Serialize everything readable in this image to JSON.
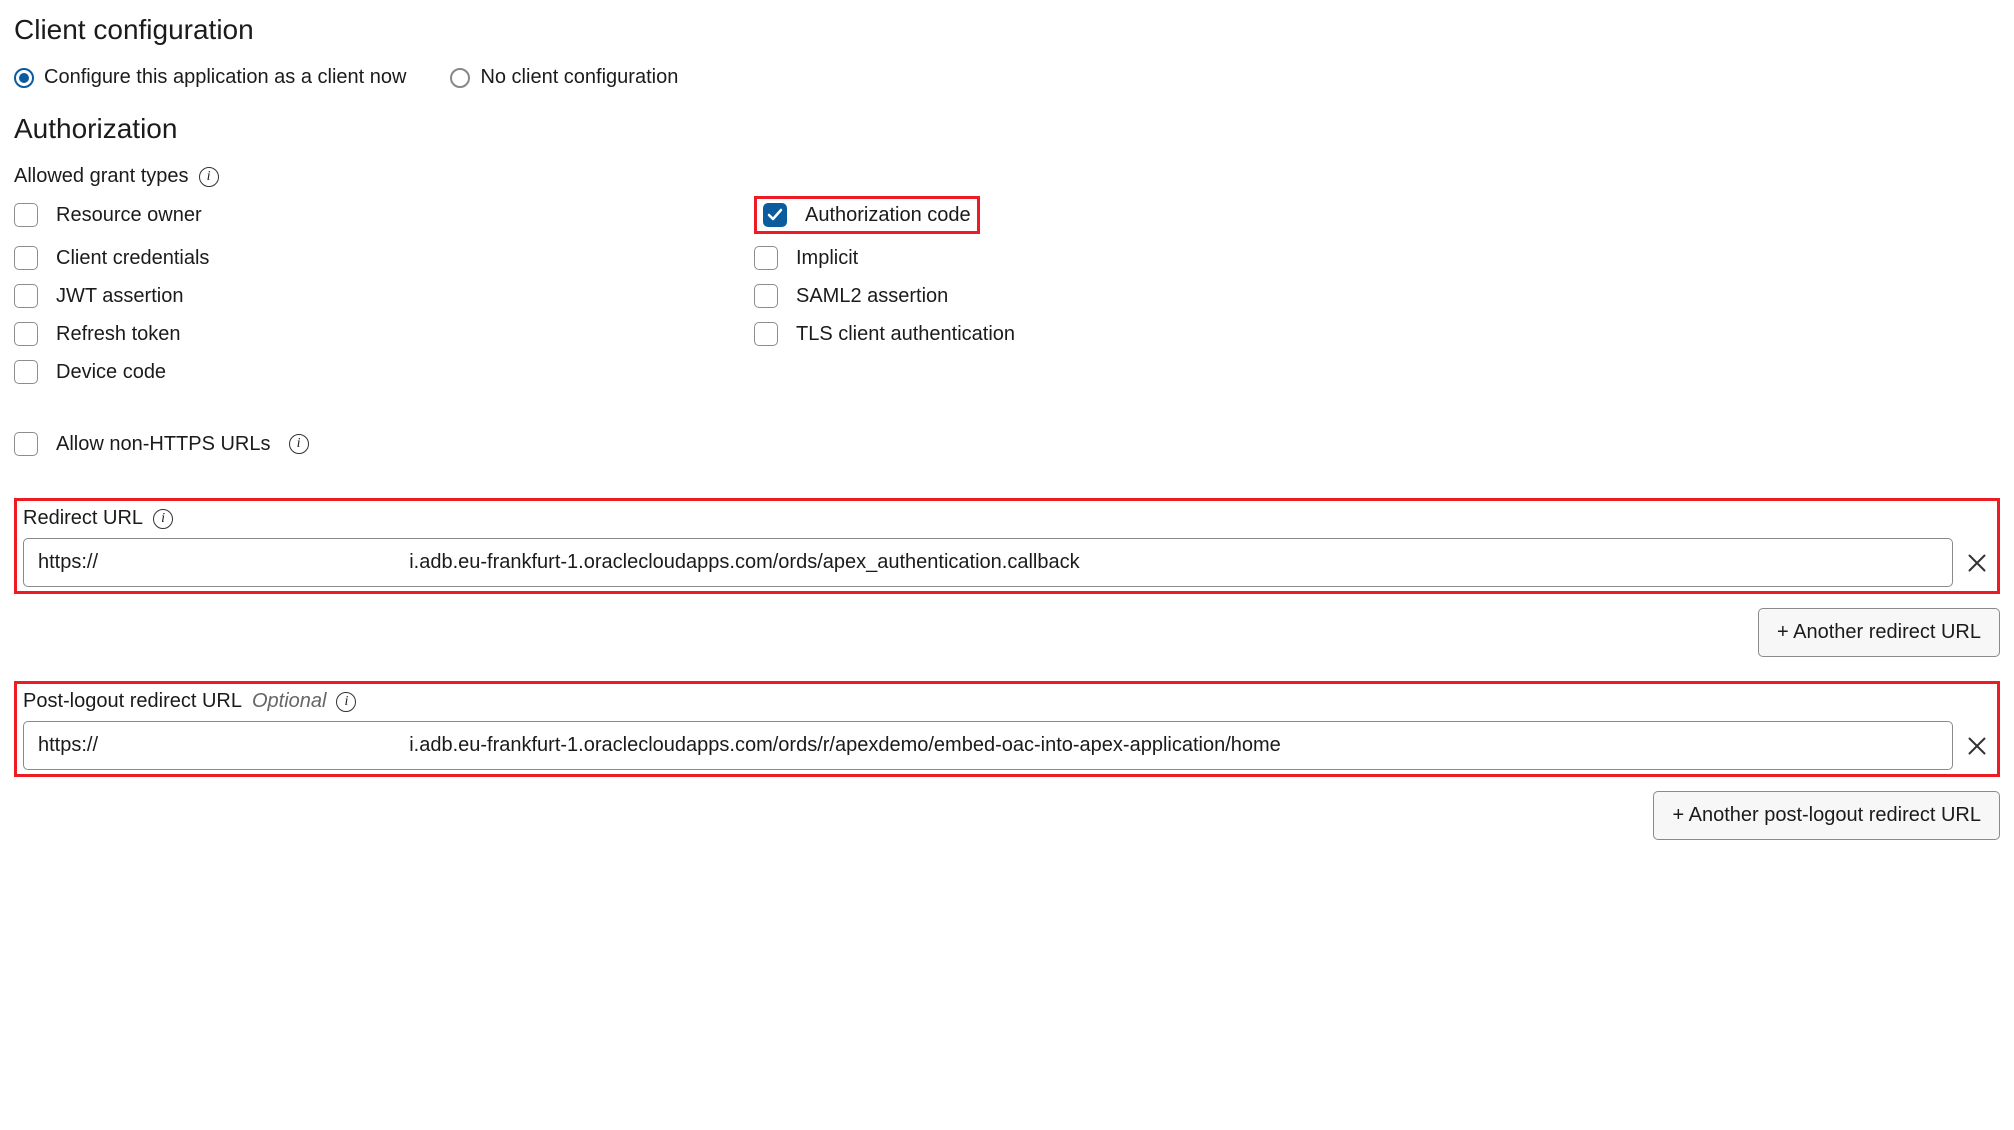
{
  "headings": {
    "client_config": "Client configuration",
    "authorization": "Authorization"
  },
  "radios": {
    "configure_now": "Configure this application as a client now",
    "no_config": "No client configuration"
  },
  "labels": {
    "allowed_grant_types": "Allowed grant types",
    "allow_non_https": "Allow non-HTTPS URLs",
    "redirect_url": "Redirect URL",
    "post_logout_redirect_url": "Post-logout redirect URL",
    "optional": "Optional"
  },
  "grant_types": {
    "left": [
      "Resource owner",
      "Client credentials",
      "JWT assertion",
      "Refresh token",
      "Device code"
    ],
    "right": [
      "Authorization code",
      "Implicit",
      "SAML2 assertion",
      "TLS client authentication"
    ]
  },
  "urls": {
    "redirect_value": "https://                                                        i.adb.eu-frankfurt-1.oraclecloudapps.com/ords/apex_authentication.callback",
    "post_logout_value": "https://                                                        i.adb.eu-frankfurt-1.oraclecloudapps.com/ords/r/apexdemo/embed-oac-into-apex-application/home"
  },
  "buttons": {
    "add_redirect": "+ Another redirect URL",
    "add_post_logout": "+ Another post-logout redirect URL"
  }
}
